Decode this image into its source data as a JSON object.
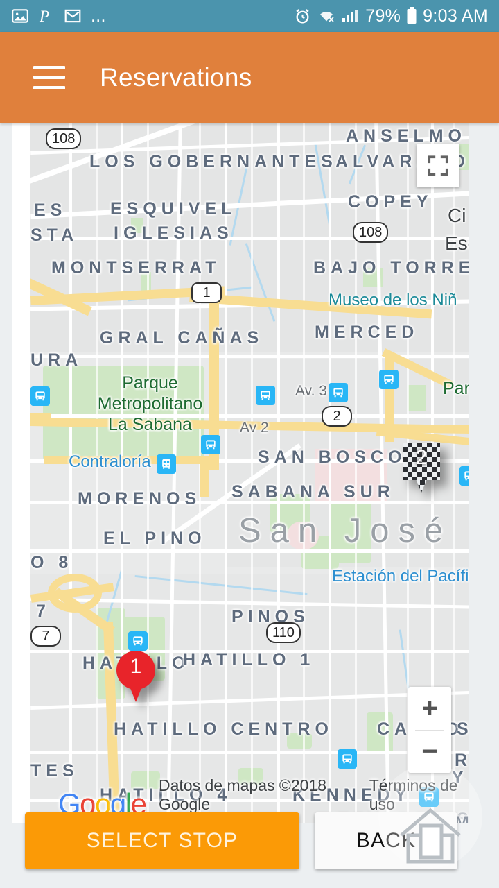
{
  "status_bar": {
    "background_color": "#4b94ad",
    "left_icons": [
      "image-icon",
      "pinterest-icon",
      "gmail-icon",
      "more-icon"
    ],
    "more_label": "...",
    "right_icons": [
      "alarm-icon",
      "wifi-icon",
      "signal-icon",
      "battery-icon"
    ],
    "battery_percent": "79%",
    "time": "9:03 AM"
  },
  "app_bar": {
    "background_color": "#e0803c",
    "menu_icon": "hamburger-icon",
    "title": "Reservations"
  },
  "map": {
    "controls": {
      "fullscreen_icon": "fullscreen-icon",
      "zoom_in": "+",
      "zoom_out": "−"
    },
    "markers": [
      {
        "id": "1",
        "label": "1",
        "type": "pin",
        "color": "#e8242a"
      },
      {
        "id": "2",
        "label": "2",
        "type": "checkered-flag"
      }
    ],
    "attribution": {
      "logo_letters": [
        "G",
        "o",
        "o",
        "g",
        "l",
        "e"
      ],
      "data_text": "Datos de mapas ©2018 Google",
      "terms_text": "Términos de uso"
    },
    "neighborhood_labels": [
      "LOS GOBERNANTES",
      "ANSELMO",
      "ALVARADO",
      "COPEY",
      "ESQUIVEL",
      "IGLESIAS",
      "ES",
      "STA",
      "MONTSERRAT",
      "BAJO TORRE",
      "GRAL CAÑAS",
      "URA",
      "MERCED",
      "SAN BOSCO",
      "SABANA SUR",
      "MORENOS",
      "EL PINO",
      "PINOS",
      "HATILLO",
      "HATILLO 1",
      "HATILLO CENTRO",
      "CAÑAD",
      "SU",
      "RO",
      "HATILLO 4",
      "KENNEDY",
      "SAN SEBAS",
      "TES",
      "O 8",
      "7",
      "Y",
      "M"
    ],
    "city_label": "San José",
    "place_labels": [
      "Parque\nMetropolitano\nLa Sabana",
      "Museo de los Niñ",
      "Contraloría",
      "Estación del Pacífico",
      "Parq",
      "Ci",
      "Esq"
    ],
    "street_labels": [
      "Av. 3",
      "Av 2"
    ],
    "highway_shields": [
      "108",
      "108",
      "1",
      "2",
      "110",
      "7"
    ]
  },
  "buttons": {
    "select_stop": "SELECT STOP",
    "back": "BACK",
    "select_stop_color": "#fb9a06"
  }
}
